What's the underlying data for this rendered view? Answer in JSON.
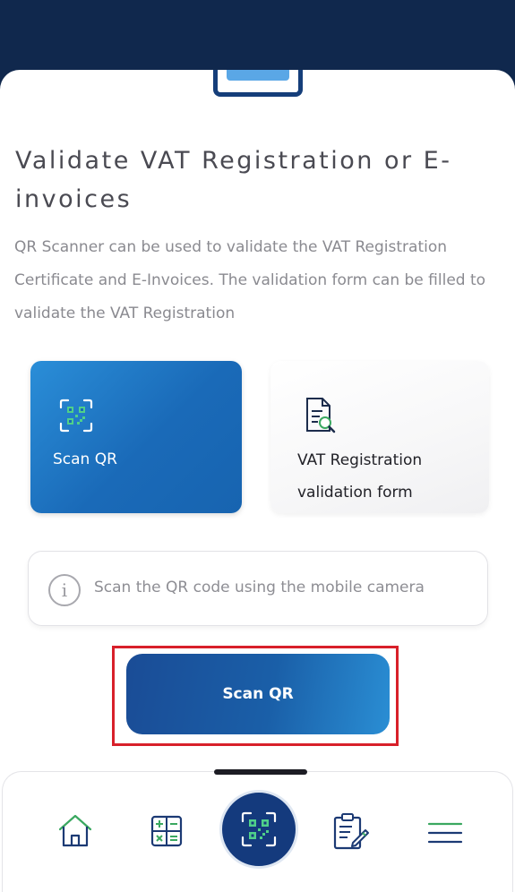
{
  "header": {
    "title": "Validate VAT Registration or E-invoices",
    "description": "QR Scanner can be used to validate the VAT Registration Certificate and E-Invoices.   The validation form can be filled to validate the VAT Registration"
  },
  "options": [
    {
      "label": "Scan QR",
      "icon": "qr-scan-icon"
    },
    {
      "label": "VAT Registration validation form",
      "icon": "document-search-icon"
    }
  ],
  "info": {
    "text": "Scan the QR code using the mobile camera",
    "icon": "info-icon"
  },
  "primary_action": {
    "label": "Scan QR"
  },
  "bottom_nav": {
    "items": [
      {
        "icon": "home-icon"
      },
      {
        "icon": "calculator-icon"
      },
      {
        "icon": "qr-scan-icon",
        "active": true
      },
      {
        "icon": "clipboard-edit-icon"
      },
      {
        "icon": "menu-icon"
      }
    ]
  },
  "colors": {
    "brand_dark": "#10284d",
    "brand_blue": "#1a5fa8",
    "accent_green": "#3aa860",
    "highlight_red": "#d8202a"
  }
}
